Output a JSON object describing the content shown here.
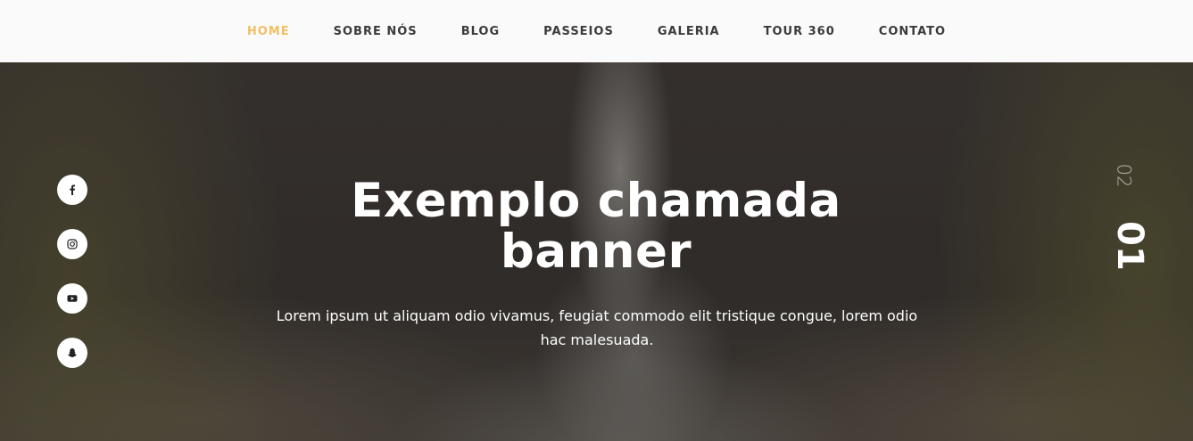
{
  "nav": {
    "items": [
      {
        "label": "HOME",
        "active": true
      },
      {
        "label": "SOBRE NÓS",
        "active": false
      },
      {
        "label": "BLOG",
        "active": false
      },
      {
        "label": "PASSEIOS",
        "active": false
      },
      {
        "label": "GALERIA",
        "active": false
      },
      {
        "label": "TOUR 360",
        "active": false
      },
      {
        "label": "CONTATO",
        "active": false
      }
    ],
    "active_color": "#f2c063"
  },
  "hero": {
    "title_line1": "Exemplo chamada",
    "title_line2": "banner",
    "subtitle": "Lorem ipsum ut aliquam odio vivamus, feugiat commodo elit tristique congue, lorem odio hac malesuada."
  },
  "socials": [
    {
      "icon": "facebook-icon"
    },
    {
      "icon": "instagram-icon"
    },
    {
      "icon": "youtube-icon"
    },
    {
      "icon": "snapchat-icon"
    }
  ],
  "slides": {
    "current": "01",
    "next": "02"
  }
}
